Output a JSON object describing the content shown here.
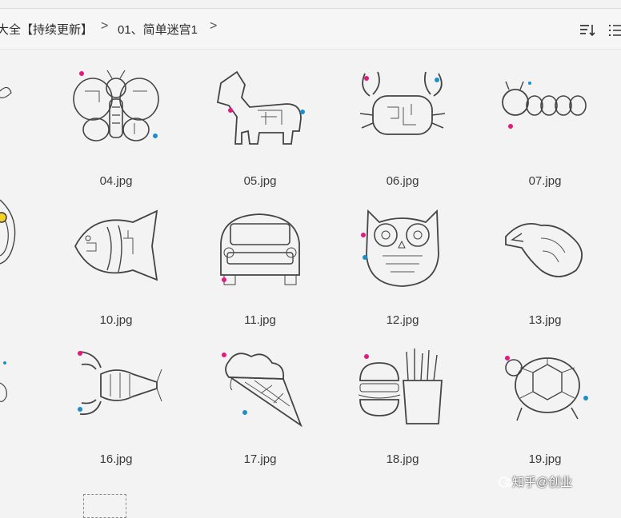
{
  "breadcrumb": {
    "part1": "大全【持续更新】",
    "separator": ">",
    "part2": "01、简单迷宫1"
  },
  "toolbar": {
    "sort_icon": "sort-descending-icon",
    "view_icon": "list-view-icon"
  },
  "files": [
    {
      "name": "04.jpg",
      "icon": "butterfly-maze-thumbnail"
    },
    {
      "name": "05.jpg",
      "icon": "horse-maze-thumbnail"
    },
    {
      "name": "06.jpg",
      "icon": "crab-maze-thumbnail"
    },
    {
      "name": "07.jpg",
      "icon": "caterpillar-maze-thumbnail"
    },
    {
      "name": "10.jpg",
      "icon": "fish-maze-thumbnail"
    },
    {
      "name": "11.jpg",
      "icon": "car-maze-thumbnail"
    },
    {
      "name": "12.jpg",
      "icon": "owl-maze-thumbnail"
    },
    {
      "name": "13.jpg",
      "icon": "bird-maze-thumbnail"
    },
    {
      "name": "16.jpg",
      "icon": "lobster-maze-thumbnail"
    },
    {
      "name": "17.jpg",
      "icon": "ice-cream-maze-thumbnail"
    },
    {
      "name": "18.jpg",
      "icon": "burger-fries-maze-thumbnail"
    },
    {
      "name": "19.jpg",
      "icon": "turtle-maze-thumbnail"
    }
  ],
  "watermark": "知乎@创业",
  "colors": {
    "accent_start": "#e8177f",
    "accent_end": "#1a8fc9"
  }
}
